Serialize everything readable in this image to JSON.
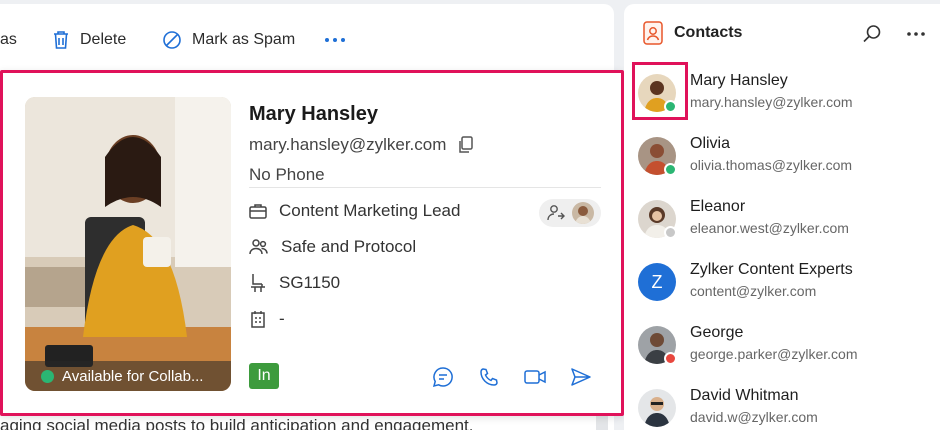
{
  "toolbar": {
    "truncated_label": "as",
    "delete_label": "Delete",
    "spam_label": "Mark as Spam"
  },
  "mail": {
    "body_text": "aging social media posts to build anticipation and engagement."
  },
  "card": {
    "name": "Mary Hansley",
    "email": "mary.hansley@zylker.com",
    "phone": "No Phone",
    "title": "Content Marketing Lead",
    "department": "Safe and Protocol",
    "seat": "SG1150",
    "extra": "-",
    "availability": "Available for Collab...",
    "linkedin_label": "In",
    "status_color": "#2bb673",
    "accent_color": "#e0125a"
  },
  "contacts": {
    "title": "Contacts",
    "items": [
      {
        "name": "Mary Hansley",
        "email": "mary.hansley@zylker.com",
        "status": "online",
        "status_color": "#2bb673"
      },
      {
        "name": "Olivia",
        "email": "olivia.thomas@zylker.com",
        "status": "online",
        "status_color": "#2bb673"
      },
      {
        "name": "Eleanor",
        "email": "eleanor.west@zylker.com",
        "status": "offline",
        "status_color": "#c8c8c8"
      },
      {
        "name": "Zylker Content Experts",
        "email": "content@zylker.com",
        "initial": "Z"
      },
      {
        "name": "George",
        "email": "george.parker@zylker.com",
        "status": "busy",
        "status_color": "#e8473e"
      },
      {
        "name": "David Whitman",
        "email": "david.w@zylker.com"
      }
    ]
  }
}
